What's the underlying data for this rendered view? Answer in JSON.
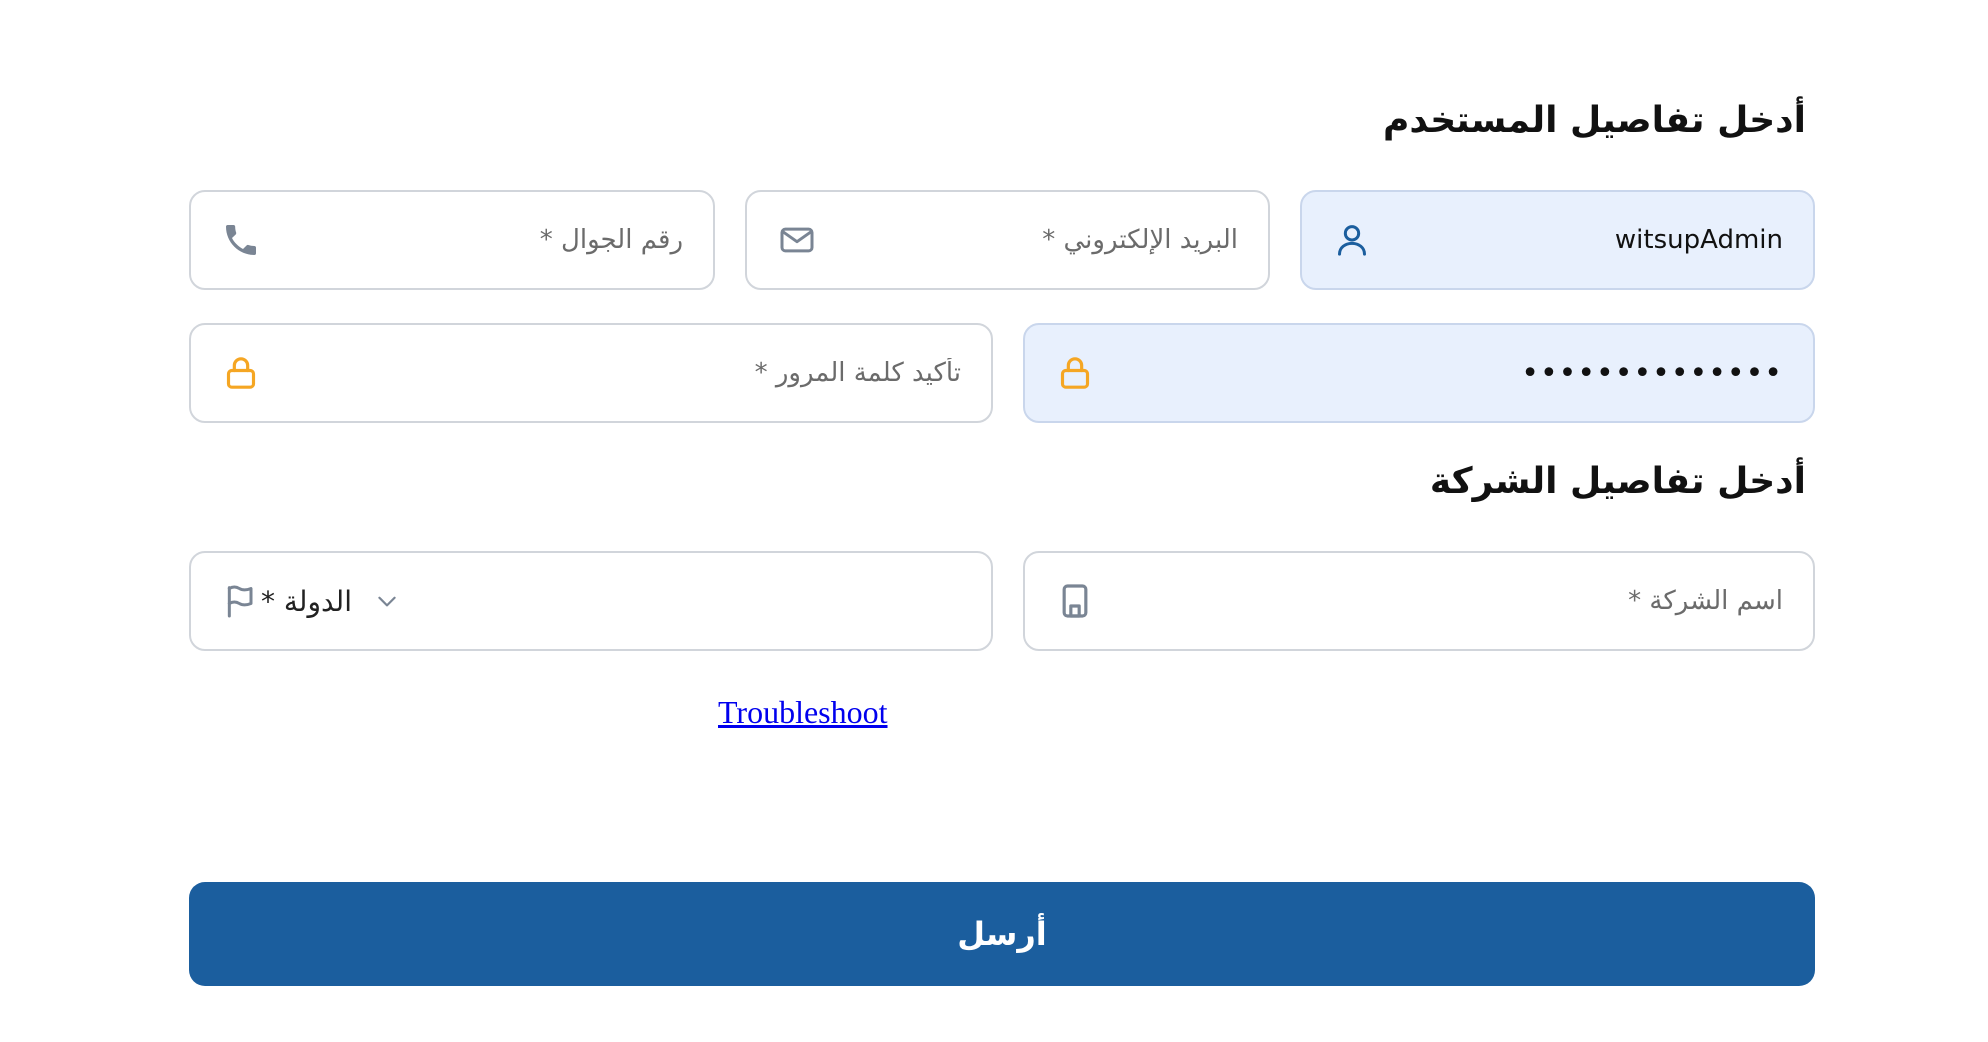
{
  "user_section": {
    "heading": "أدخل تفاصيل المستخدم",
    "username": {
      "value": "witsupAdmin",
      "icon": "user-icon"
    },
    "email": {
      "placeholder": "البريد الإلكتروني *",
      "icon": "mail-icon"
    },
    "phone": {
      "placeholder": "رقم الجوال *",
      "icon": "phone-icon"
    },
    "password": {
      "value": "••••••••••••••",
      "icon": "lock-icon"
    },
    "confirm_password": {
      "placeholder": "تأكيد كلمة المرور *",
      "icon": "lock-icon"
    }
  },
  "company_section": {
    "heading": "أدخل تفاصيل الشركة",
    "company_name": {
      "placeholder": "اسم الشركة *",
      "icon": "building-icon"
    },
    "country": {
      "selected": "الدولة *",
      "icon": "flag-icon"
    }
  },
  "troubleshoot_link": "Troubleshoot",
  "submit_label": "أرسل",
  "colors": {
    "primary": "#1b5e9e",
    "filled_bg": "#e8f0fd",
    "border": "#d1d5db",
    "lock_icon": "#f5a623",
    "user_icon": "#1b5e9e",
    "muted_icon": "#7a8594",
    "link": "#0000ee"
  }
}
